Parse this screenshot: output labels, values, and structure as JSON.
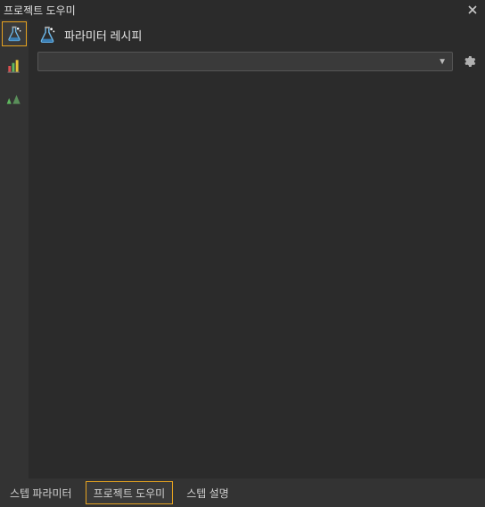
{
  "titlebar": {
    "title": "프로젝트 도우미"
  },
  "header": {
    "title": "파라미터 레시피"
  },
  "dropdown": {
    "value": ""
  },
  "sidebar": {
    "items": [
      {
        "name": "flask-icon",
        "active": true
      },
      {
        "name": "barchart-icon",
        "active": false
      },
      {
        "name": "triangle-icon",
        "active": false
      }
    ]
  },
  "bottom_tabs": [
    {
      "label": "스텝 파라미터",
      "active": false
    },
    {
      "label": "프로젝트 도우미",
      "active": true
    },
    {
      "label": "스텝 설명",
      "active": false
    }
  ]
}
